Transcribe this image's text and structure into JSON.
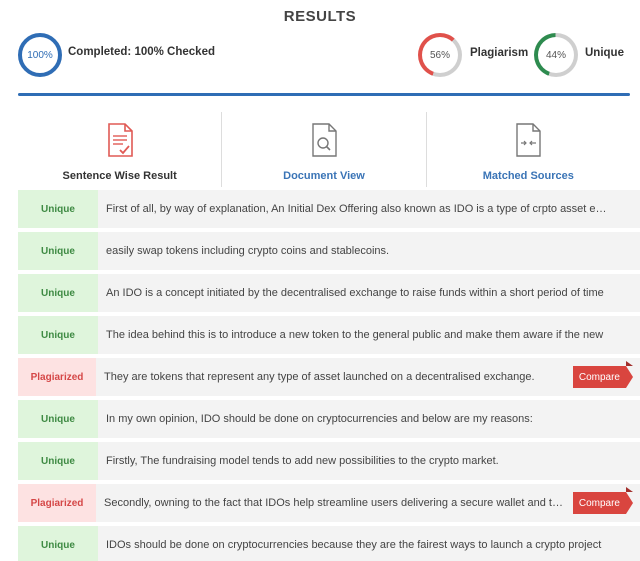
{
  "header": {
    "title": "RESULTS"
  },
  "stats": {
    "completed": {
      "ring_value": "100%",
      "label": "Completed: 100% Checked",
      "percent": 100,
      "color": "#2f6db5"
    },
    "plagiarism": {
      "ring_value": "56%",
      "label": "Plagiarism",
      "percent": 56,
      "color": "#e0514b"
    },
    "unique": {
      "ring_value": "44%",
      "label": "Unique",
      "percent": 44,
      "color": "#2e8b4f"
    }
  },
  "tabs": [
    {
      "label": "Sentence Wise Result",
      "icon": "document-check-icon",
      "active": true
    },
    {
      "label": "Document View",
      "icon": "document-search-icon",
      "active": false
    },
    {
      "label": "Matched Sources",
      "icon": "document-compare-icon",
      "active": false
    }
  ],
  "compare_label": "Compare",
  "rows": [
    {
      "status": "Unique",
      "text": "First of all, by way of explanation, An Initial Dex Offering also known as IDO is a type of crpto asset exchange"
    },
    {
      "status": "Unique",
      "text": "easily swap tokens including crypto coins and stablecoins."
    },
    {
      "status": "Unique",
      "text": "An IDO is a concept initiated by the decentralised exchange to raise funds within a short period of time"
    },
    {
      "status": "Unique",
      "text": "The idea behind this is to introduce a new token to the general public and make them aware if the new"
    },
    {
      "status": "Plagiarized",
      "text": "They are tokens that represent any type of asset launched on a decentralised exchange."
    },
    {
      "status": "Unique",
      "text": "In my own opinion, IDO should be done on cryptocurrencies and below are my reasons:"
    },
    {
      "status": "Unique",
      "text": "Firstly, The fundraising model tends to add new possibilities to the crypto market."
    },
    {
      "status": "Plagiarized",
      "text": "Secondly, owning to the fact that IDOs help streamline users delivering a secure wallet and trading"
    },
    {
      "status": "Unique",
      "text": "IDOs should be done on cryptocurrencies because they are the fairest ways to launch a crypto project"
    }
  ]
}
